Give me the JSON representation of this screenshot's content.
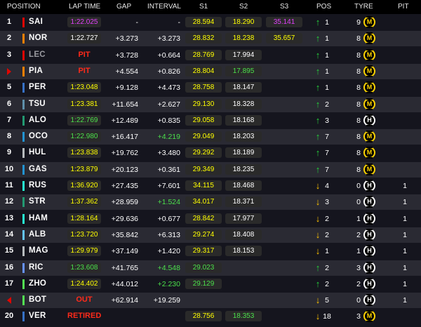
{
  "colors": {
    "background": "#15151e",
    "row_alt": "#2a2a33",
    "white": "#ffffff",
    "yellow": "#ffff00",
    "green": "#4be04b",
    "purple": "#e040fb",
    "red": "#ff2a1a",
    "gray_text": "#9a9aa0",
    "pos_up": "#26d13c",
    "pos_down": "#ffc400",
    "medium_tyre": "#ffd400",
    "hard_tyre": "#ffffff"
  },
  "header": {
    "position": "POSITION",
    "lap_time": "LAP TIME",
    "gap": "GAP",
    "interval": "INTERVAL",
    "s1": "S1",
    "s2": "S2",
    "s3": "S3",
    "pos": "POS",
    "tyre": "TYRE",
    "pit": "PIT"
  },
  "rows": [
    {
      "pos": "1",
      "code": "SAI",
      "team_color": "#e10600",
      "lap": "1:22.025",
      "lap_color": "#e040fb",
      "gap": "-",
      "interval": "-",
      "int_color": "#ffffff",
      "s1": "28.594",
      "s1_color": "#ffff00",
      "s2": "18.290",
      "s2_color": "#ffff00",
      "s3": "35.141",
      "s3_color": "#e040fb",
      "dir": "↑",
      "dir_color": "#26d13c",
      "change": "1",
      "laps": "9",
      "tyre": "M",
      "tyre_type": "medium",
      "pit": ""
    },
    {
      "pos": "2",
      "code": "NOR",
      "team_color": "#ff8000",
      "lap": "1:22.727",
      "lap_color": "#ffffff",
      "gap": "+3.273",
      "interval": "+3.273",
      "int_color": "#ffffff",
      "s1": "28.832",
      "s1_color": "#ffff00",
      "s2": "18.238",
      "s2_color": "#ffff00",
      "s3": "35.657",
      "s3_color": "#ffff00",
      "dir": "↑",
      "dir_color": "#26d13c",
      "change": "1",
      "laps": "8",
      "tyre": "M",
      "tyre_type": "medium",
      "pit": ""
    },
    {
      "pos": "3",
      "code": "LEC",
      "team_color": "#e10600",
      "marker": "",
      "dim": true,
      "lap": "PIT",
      "lap_color": "#ff2a1a",
      "lap_word": true,
      "gap": "+3.728",
      "interval": "+0.664",
      "int_color": "#ffffff",
      "s1": "28.769",
      "s1_color": "#ffff00",
      "s2": "17.994",
      "s2_color": "#ffffff",
      "s3": "",
      "dir": "↑",
      "dir_color": "#26d13c",
      "change": "1",
      "laps": "8",
      "tyre": "M",
      "tyre_type": "medium",
      "pit": ""
    },
    {
      "pos": "",
      "code": "PIA",
      "team_color": "#ff8000",
      "marker": "in",
      "lap": "PIT",
      "lap_color": "#ff2a1a",
      "lap_word": true,
      "gap": "+4.554",
      "interval": "+0.826",
      "int_color": "#ffffff",
      "s1": "28.804",
      "s1_color": "#ffff00",
      "s2": "17.895",
      "s2_color": "#4be04b",
      "s3": "",
      "dir": "↑",
      "dir_color": "#26d13c",
      "change": "1",
      "laps": "8",
      "tyre": "M",
      "tyre_type": "medium",
      "pit": ""
    },
    {
      "pos": "5",
      "code": "PER",
      "team_color": "#3671c6",
      "lap": "1:23.048",
      "lap_color": "#ffff00",
      "gap": "+9.128",
      "interval": "+4.473",
      "int_color": "#ffffff",
      "s1": "28.758",
      "s1_color": "#ffff00",
      "s2": "18.147",
      "s2_color": "#ffffff",
      "s3": "",
      "dir": "↑",
      "dir_color": "#26d13c",
      "change": "1",
      "laps": "8",
      "tyre": "M",
      "tyre_type": "medium",
      "pit": ""
    },
    {
      "pos": "6",
      "code": "TSU",
      "team_color": "#5e8faa",
      "lap": "1:23.381",
      "lap_color": "#ffff00",
      "gap": "+11.654",
      "interval": "+2.627",
      "int_color": "#ffffff",
      "s1": "29.130",
      "s1_color": "#ffff00",
      "s2": "18.328",
      "s2_color": "#ffffff",
      "s3": "",
      "dir": "↑",
      "dir_color": "#26d13c",
      "change": "2",
      "laps": "8",
      "tyre": "M",
      "tyre_type": "medium",
      "pit": ""
    },
    {
      "pos": "7",
      "code": "ALO",
      "team_color": "#229971",
      "lap": "1:22.769",
      "lap_color": "#4be04b",
      "gap": "+12.489",
      "interval": "+0.835",
      "int_color": "#ffffff",
      "s1": "29.058",
      "s1_color": "#ffff00",
      "s2": "18.168",
      "s2_color": "#ffffff",
      "s3": "",
      "dir": "↑",
      "dir_color": "#26d13c",
      "change": "3",
      "laps": "8",
      "tyre": "H",
      "tyre_type": "hard",
      "pit": ""
    },
    {
      "pos": "8",
      "code": "OCO",
      "team_color": "#2293d1",
      "lap": "1:22.980",
      "lap_color": "#4be04b",
      "gap": "+16.417",
      "interval": "+4.219",
      "int_color": "#4be04b",
      "s1": "29.049",
      "s1_color": "#ffff00",
      "s2": "18.203",
      "s2_color": "#ffffff",
      "s3": "",
      "dir": "↑",
      "dir_color": "#26d13c",
      "change": "7",
      "laps": "8",
      "tyre": "M",
      "tyre_type": "medium",
      "pit": ""
    },
    {
      "pos": "9",
      "code": "HUL",
      "team_color": "#b6babd",
      "lap": "1:23.838",
      "lap_color": "#ffff00",
      "gap": "+19.762",
      "interval": "+3.480",
      "int_color": "#ffffff",
      "s1": "29.292",
      "s1_color": "#ffff00",
      "s2": "18.189",
      "s2_color": "#ffffff",
      "s3": "",
      "dir": "↑",
      "dir_color": "#26d13c",
      "change": "7",
      "laps": "8",
      "tyre": "M",
      "tyre_type": "medium",
      "pit": ""
    },
    {
      "pos": "10",
      "code": "GAS",
      "team_color": "#2293d1",
      "lap": "1:23.879",
      "lap_color": "#ffff00",
      "gap": "+20.123",
      "interval": "+0.361",
      "int_color": "#ffffff",
      "s1": "29.349",
      "s1_color": "#ffff00",
      "s2": "18.235",
      "s2_color": "#ffffff",
      "s3": "",
      "dir": "↑",
      "dir_color": "#26d13c",
      "change": "7",
      "laps": "8",
      "tyre": "M",
      "tyre_type": "medium",
      "pit": ""
    },
    {
      "pos": "11",
      "code": "RUS",
      "team_color": "#27f4d2",
      "lap": "1:36.920",
      "lap_color": "#ffff00",
      "gap": "+27.435",
      "interval": "+7.601",
      "int_color": "#ffffff",
      "s1": "34.115",
      "s1_color": "#ffff00",
      "s2": "18.468",
      "s2_color": "#ffffff",
      "s3": "",
      "dir": "↓",
      "dir_color": "#ffc400",
      "change": "4",
      "laps": "0",
      "tyre": "H",
      "tyre_type": "hard",
      "pit": "1"
    },
    {
      "pos": "12",
      "code": "STR",
      "team_color": "#229971",
      "lap": "1:37.362",
      "lap_color": "#ffff00",
      "gap": "+28.959",
      "interval": "+1.524",
      "int_color": "#4be04b",
      "s1": "34.017",
      "s1_color": "#ffff00",
      "s2": "18.371",
      "s2_color": "#ffffff",
      "s3": "",
      "dir": "↓",
      "dir_color": "#ffc400",
      "change": "3",
      "laps": "0",
      "tyre": "H",
      "tyre_type": "hard",
      "pit": "1"
    },
    {
      "pos": "13",
      "code": "HAM",
      "team_color": "#27f4d2",
      "lap": "1:28.164",
      "lap_color": "#ffff00",
      "gap": "+29.636",
      "interval": "+0.677",
      "int_color": "#ffffff",
      "s1": "28.842",
      "s1_color": "#ffff00",
      "s2": "17.977",
      "s2_color": "#ffffff",
      "s3": "",
      "dir": "↓",
      "dir_color": "#ffc400",
      "change": "2",
      "laps": "1",
      "tyre": "H",
      "tyre_type": "hard",
      "pit": "1"
    },
    {
      "pos": "14",
      "code": "ALB",
      "team_color": "#64c4ff",
      "lap": "1:23.720",
      "lap_color": "#ffff00",
      "gap": "+35.842",
      "interval": "+6.313",
      "int_color": "#ffffff",
      "s1": "29.274",
      "s1_color": "#ffff00",
      "s2": "18.408",
      "s2_color": "#ffffff",
      "s3": "",
      "dir": "↓",
      "dir_color": "#ffc400",
      "change": "2",
      "laps": "2",
      "tyre": "H",
      "tyre_type": "hard",
      "pit": "1"
    },
    {
      "pos": "15",
      "code": "MAG",
      "team_color": "#b6babd",
      "lap": "1:29.979",
      "lap_color": "#ffff00",
      "gap": "+37.149",
      "interval": "+1.420",
      "int_color": "#ffffff",
      "s1": "29.317",
      "s1_color": "#ffff00",
      "s2": "18.153",
      "s2_color": "#ffffff",
      "s3": "",
      "dir": "↓",
      "dir_color": "#ffc400",
      "change": "1",
      "laps": "1",
      "tyre": "H",
      "tyre_type": "hard",
      "pit": "1"
    },
    {
      "pos": "16",
      "code": "RIC",
      "team_color": "#6692ff",
      "lap": "1:23.608",
      "lap_color": "#4be04b",
      "gap": "+41.765",
      "interval": "+4.548",
      "int_color": "#4be04b",
      "s1": "29.023",
      "s1_color": "#4be04b",
      "s2": "",
      "s2_color": "#ffffff",
      "s3": "",
      "dir": "↑",
      "dir_color": "#26d13c",
      "change": "2",
      "laps": "3",
      "tyre": "H",
      "tyre_type": "hard",
      "pit": "1"
    },
    {
      "pos": "17",
      "code": "ZHO",
      "team_color": "#52e252",
      "lap": "1:24.402",
      "lap_color": "#ffff00",
      "gap": "+44.012",
      "interval": "+2.230",
      "int_color": "#4be04b",
      "s1": "29.129",
      "s1_color": "#4be04b",
      "s2": "",
      "s2_color": "#ffffff",
      "s3": "",
      "dir": "↑",
      "dir_color": "#26d13c",
      "change": "2",
      "laps": "2",
      "tyre": "H",
      "tyre_type": "hard",
      "pit": "1"
    },
    {
      "pos": "",
      "code": "BOT",
      "team_color": "#52e252",
      "marker": "out",
      "lap": "OUT",
      "lap_color": "#ff2a1a",
      "lap_word": true,
      "gap": "+62.914",
      "interval": "+19.259",
      "int_color": "#ffffff",
      "s1": "",
      "s1_color": "#ffff00",
      "s2": "",
      "s2_color": "#ffffff",
      "s3": "",
      "dir": "↓",
      "dir_color": "#ffc400",
      "change": "5",
      "laps": "0",
      "tyre": "H",
      "tyre_type": "hard",
      "pit": "1"
    },
    {
      "pos": "20",
      "code": "VER",
      "team_color": "#3671c6",
      "lap": "RETIRED",
      "lap_color": "#ff2a1a",
      "lap_word": true,
      "gap": "",
      "interval": "",
      "int_color": "#ffffff",
      "s1": "28.756",
      "s1_color": "#ffff00",
      "s2": "18.353",
      "s2_color": "#4be04b",
      "s3": "",
      "dir": "↓",
      "dir_color": "#ffc400",
      "change": "18",
      "laps": "3",
      "tyre": "M",
      "tyre_type": "medium",
      "pit": ""
    }
  ]
}
